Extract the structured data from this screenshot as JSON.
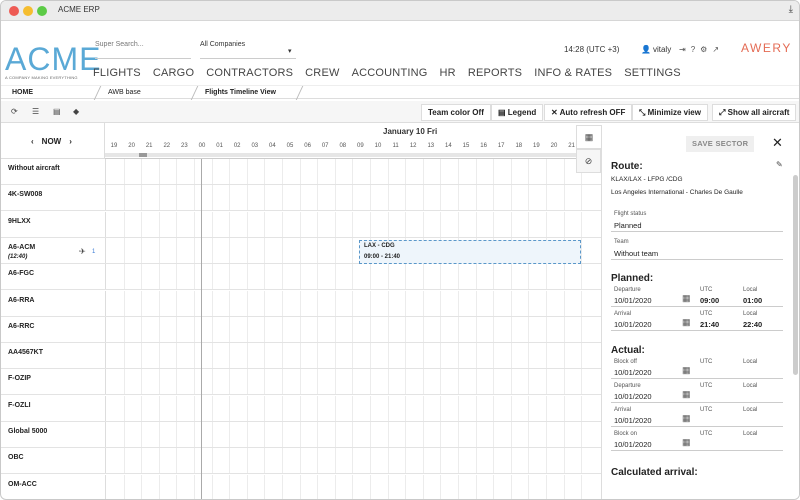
{
  "window": {
    "title": "ACME ERP"
  },
  "header": {
    "logo": "ACME",
    "logo_tag": "A COMPANY MAKING EVERYTHING",
    "search_placeholder": "Super Search...",
    "company_select": "All Companies",
    "time": "14:28 (UTC +3)",
    "user": "vitaly",
    "brand": "AWERY",
    "nav": [
      "FLIGHTS",
      "CARGO",
      "CONTRACTORS",
      "CREW",
      "ACCOUNTING",
      "HR",
      "REPORTS",
      "INFO & RATES",
      "SETTINGS"
    ]
  },
  "breadcrumbs": [
    "HOME",
    "AWB base",
    "Flights Timeline View"
  ],
  "toolbar": {
    "team_color": "Team color Off",
    "legend": "Legend",
    "auto_refresh": "Auto refresh OFF",
    "minimize": "Minimize view",
    "show_all": "Show all aircraft"
  },
  "timeline": {
    "now_label": "NOW",
    "date": "January 10 Fri",
    "hours": [
      "19",
      "20",
      "21",
      "22",
      "23",
      "00",
      "01",
      "02",
      "03",
      "04",
      "05",
      "06",
      "07",
      "08",
      "09",
      "10",
      "11",
      "12",
      "13",
      "14",
      "15",
      "16",
      "17",
      "18",
      "19",
      "20",
      "21"
    ],
    "rows": [
      {
        "label": "Without aircraft",
        "sub": ""
      },
      {
        "label": "4K-SW008",
        "sub": ""
      },
      {
        "label": "9HLXX",
        "sub": ""
      },
      {
        "label": "A6-ACM",
        "sub": "(12:40)",
        "count": "1"
      },
      {
        "label": "A6-FGC",
        "sub": ""
      },
      {
        "label": "A6-RRA",
        "sub": ""
      },
      {
        "label": "A6-RRC",
        "sub": ""
      },
      {
        "label": "AA4567KT",
        "sub": ""
      },
      {
        "label": "F-OZIP",
        "sub": ""
      },
      {
        "label": "F-OZLI",
        "sub": ""
      },
      {
        "label": "Global 5000",
        "sub": ""
      },
      {
        "label": "OBC",
        "sub": ""
      },
      {
        "label": "OM-ACC",
        "sub": ""
      }
    ],
    "flight": {
      "route": "LAX - CDG",
      "times": "09:00 - 21:40"
    }
  },
  "panel": {
    "save_label": "SAVE SECTOR",
    "route_title": "Route:",
    "route_codes": "KLAX/LAX - LFPG /CDG",
    "route_names": "Los Angeles International - Charles De Gaulle",
    "flight_status_label": "Flight status",
    "flight_status": "Planned",
    "team_label": "Team",
    "team": "Without team",
    "planned_title": "Planned:",
    "actual_title": "Actual:",
    "calc_title": "Calculated arrival:",
    "utc_label": "UTC",
    "local_label": "Local",
    "planned": [
      {
        "label": "Departure",
        "date": "10/01/2020",
        "utc": "09:00",
        "local": "01:00"
      },
      {
        "label": "Arrival",
        "date": "10/01/2020",
        "utc": "21:40",
        "local": "22:40"
      }
    ],
    "actual": [
      {
        "label": "Block off",
        "date": "10/01/2020"
      },
      {
        "label": "Departure",
        "date": "10/01/2020"
      },
      {
        "label": "Arrival",
        "date": "10/01/2020"
      },
      {
        "label": "Block on",
        "date": "10/01/2020"
      }
    ]
  }
}
